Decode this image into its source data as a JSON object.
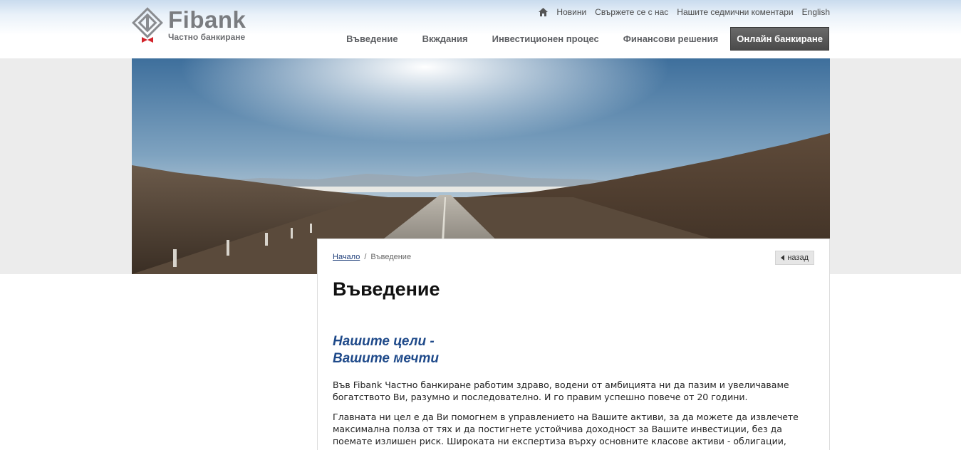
{
  "brand": {
    "name": "Fibank",
    "subtitle": "Частно банкиране"
  },
  "top_links": [
    "Новини",
    "Свържете се с нас",
    "Нашите седмични коментари",
    "English"
  ],
  "main_nav": [
    "Въведение",
    "Вкждания",
    "Инвестиционен процес",
    "Финансови решения",
    "Онлайн банкиране"
  ],
  "breadcrumb": {
    "home": "Начало",
    "separator": "/",
    "current": "Въведение"
  },
  "back_label": "назад",
  "page_title": "Въведение",
  "subheading_line1": "Нашите цели -",
  "subheading_line2": "Вашите мечти",
  "paragraphs": [
    "Във Fibank Частно банкиране работим здраво, водени от амбицията ни да пазим и увеличаваме богатството Ви, разумно и последователно. И го правим успешно повече от 20 години.",
    "Главната ни цел е да Ви помогнем в управлението на Вашите активи, за да можете да извлечете максимална полза от тях и да постигнете устойчива доходност за Вашите инвестиции, без да поемате излишен риск. Широката ни експертиза върху основните класове активи - облигации, акции, суровини и валути - ни"
  ],
  "colors": {
    "brand_grey": "#7a7c80",
    "accent_red": "#d2232a",
    "heading_blue": "#1f4a8a",
    "nav_online_bg": "#555555"
  },
  "icons": [
    "home-icon",
    "logo-mark",
    "back-arrow-icon"
  ]
}
